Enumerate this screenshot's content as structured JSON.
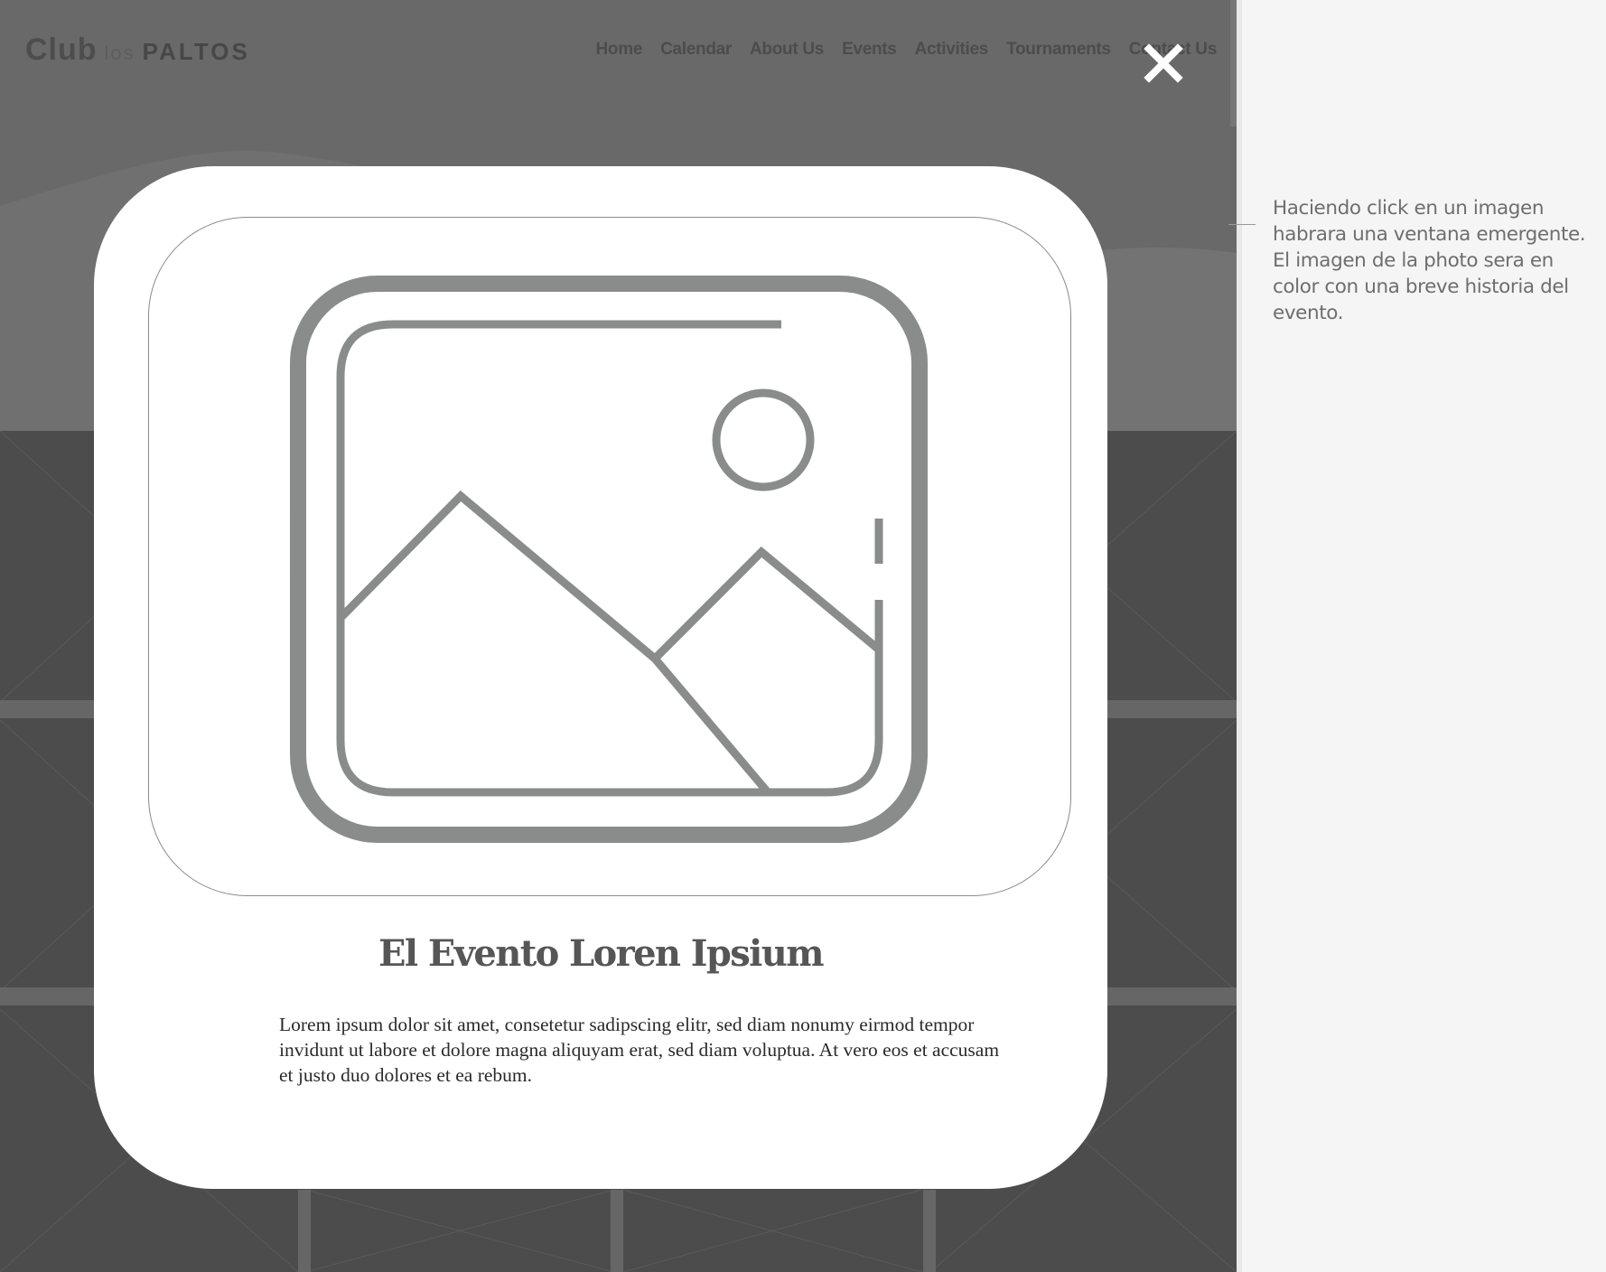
{
  "brand": {
    "logo_club": "Club",
    "logo_los": "los",
    "logo_paltos": "PALTOS"
  },
  "nav": {
    "items": [
      "Home",
      "Calendar",
      "About Us",
      "Events",
      "Activities",
      "Tournaments",
      "Contact Us"
    ]
  },
  "modal": {
    "close_icon": "close-icon",
    "image_icon": "image-placeholder-icon",
    "title": "El Evento Loren Ipsium",
    "body": "Lorem ipsum dolor sit amet, consetetur sadipscing elitr, sed diam nonumy eirmod tempor invidunt ut labore et dolore magna aliquyam erat, sed diam voluptua. At vero eos et accusam et justo duo dolores et ea rebum."
  },
  "annotation": {
    "text": "Haciendo click en un imagen habrara una ventana emergente. El imagen de la photo sera en color con una breve historia del evento."
  },
  "colors": {
    "overlay_hero": "#696969",
    "overlay_grid": "#4c4c4c",
    "modal_bg": "#ffffff",
    "icon_gray": "#8a8c8c"
  }
}
